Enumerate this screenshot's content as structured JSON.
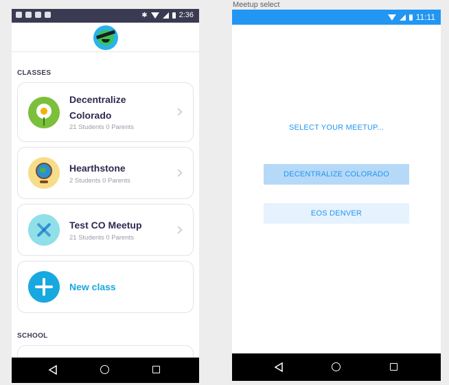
{
  "left_phone": {
    "status_bar": {
      "time": "2:36"
    },
    "sections": {
      "classes": "CLASSES",
      "school": "SCHOOL"
    },
    "classes": [
      {
        "title_line1": "Decentralize",
        "title_line2": "Colorado",
        "subtitle": "21 Students 0 Parents",
        "icon": "sunflower-icon"
      },
      {
        "title_line1": "Hearthstone",
        "subtitle": "2 Students 0 Parents",
        "icon": "globe-icon"
      },
      {
        "title_line1": "Test CO Meetup",
        "subtitle": "21 Students 0 Parents",
        "icon": "dna-icon"
      }
    ],
    "new_class_label": "New class"
  },
  "right_phone": {
    "window_title": "Meetup select",
    "status_bar": {
      "time": "11:11"
    },
    "heading": "SELECT YOUR MEETUP...",
    "buttons": [
      "DECENTRALIZE COLORADO",
      "EOS DENVER"
    ]
  },
  "colors": {
    "accent_blue": "#2196f3",
    "class_blue": "#18a8e0",
    "dark_text": "#2c2a50",
    "status_dark": "#3a3a52"
  }
}
